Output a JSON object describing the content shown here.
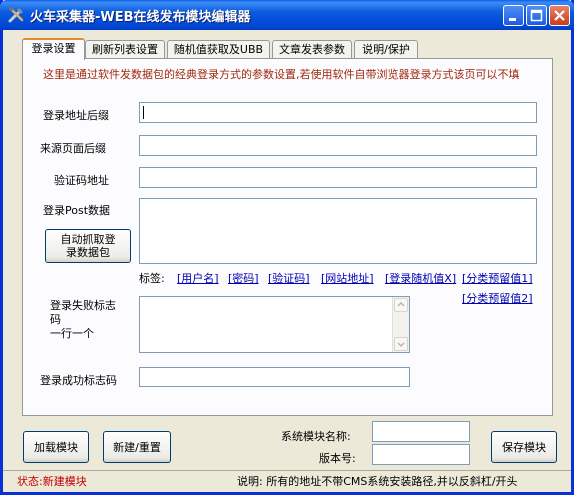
{
  "window": {
    "title": "火车采集器-WEB在线发布模块编辑器"
  },
  "tabs": [
    {
      "label": "登录设置",
      "active": true
    },
    {
      "label": "刷新列表设置",
      "active": false
    },
    {
      "label": "随机值获取及UBB",
      "active": false
    },
    {
      "label": "文章发表参数",
      "active": false
    },
    {
      "label": "说明/保护",
      "active": false
    }
  ],
  "login": {
    "hint": "这里是通过软件发数据包的经典登录方式的参数设置,若使用软件自带浏览器登录方式该页可以不填",
    "login_url_label": "登录地址后缀",
    "login_url_value": "",
    "referer_label": "来源页面后缀",
    "referer_value": "",
    "captcha_label": "验证码地址",
    "captcha_value": "",
    "post_label": "登录Post数据",
    "post_value": "",
    "auto_capture_button": "自动抓取登录数据包",
    "tags_label": "标签:",
    "tags": [
      "[用户名]",
      "[密码]",
      "[验证码]",
      "[网站地址]",
      "[登录随机值X]",
      "[分类预留值1]",
      "[分类预留值2]"
    ],
    "fail_label": "登录失败标志码\n一行一个",
    "fail_value": "",
    "success_label": "登录成功标志码",
    "success_value": ""
  },
  "footer": {
    "load_button": "加载模块",
    "new_button": "新建/重置",
    "module_name_label": "系统模块名称:",
    "module_name_value": "",
    "version_label": "版本号:",
    "version_value": "",
    "save_button": "保存模块"
  },
  "status": {
    "left": "状态:新建模块",
    "right": "说明:   所有的地址不带CMS系统安装路径,并以反斜杠/开头"
  },
  "colors": {
    "titlebar": "#0054E3",
    "hint_text": "#A0280E",
    "status_text": "#C00000",
    "tag_link": "#0000B0"
  }
}
